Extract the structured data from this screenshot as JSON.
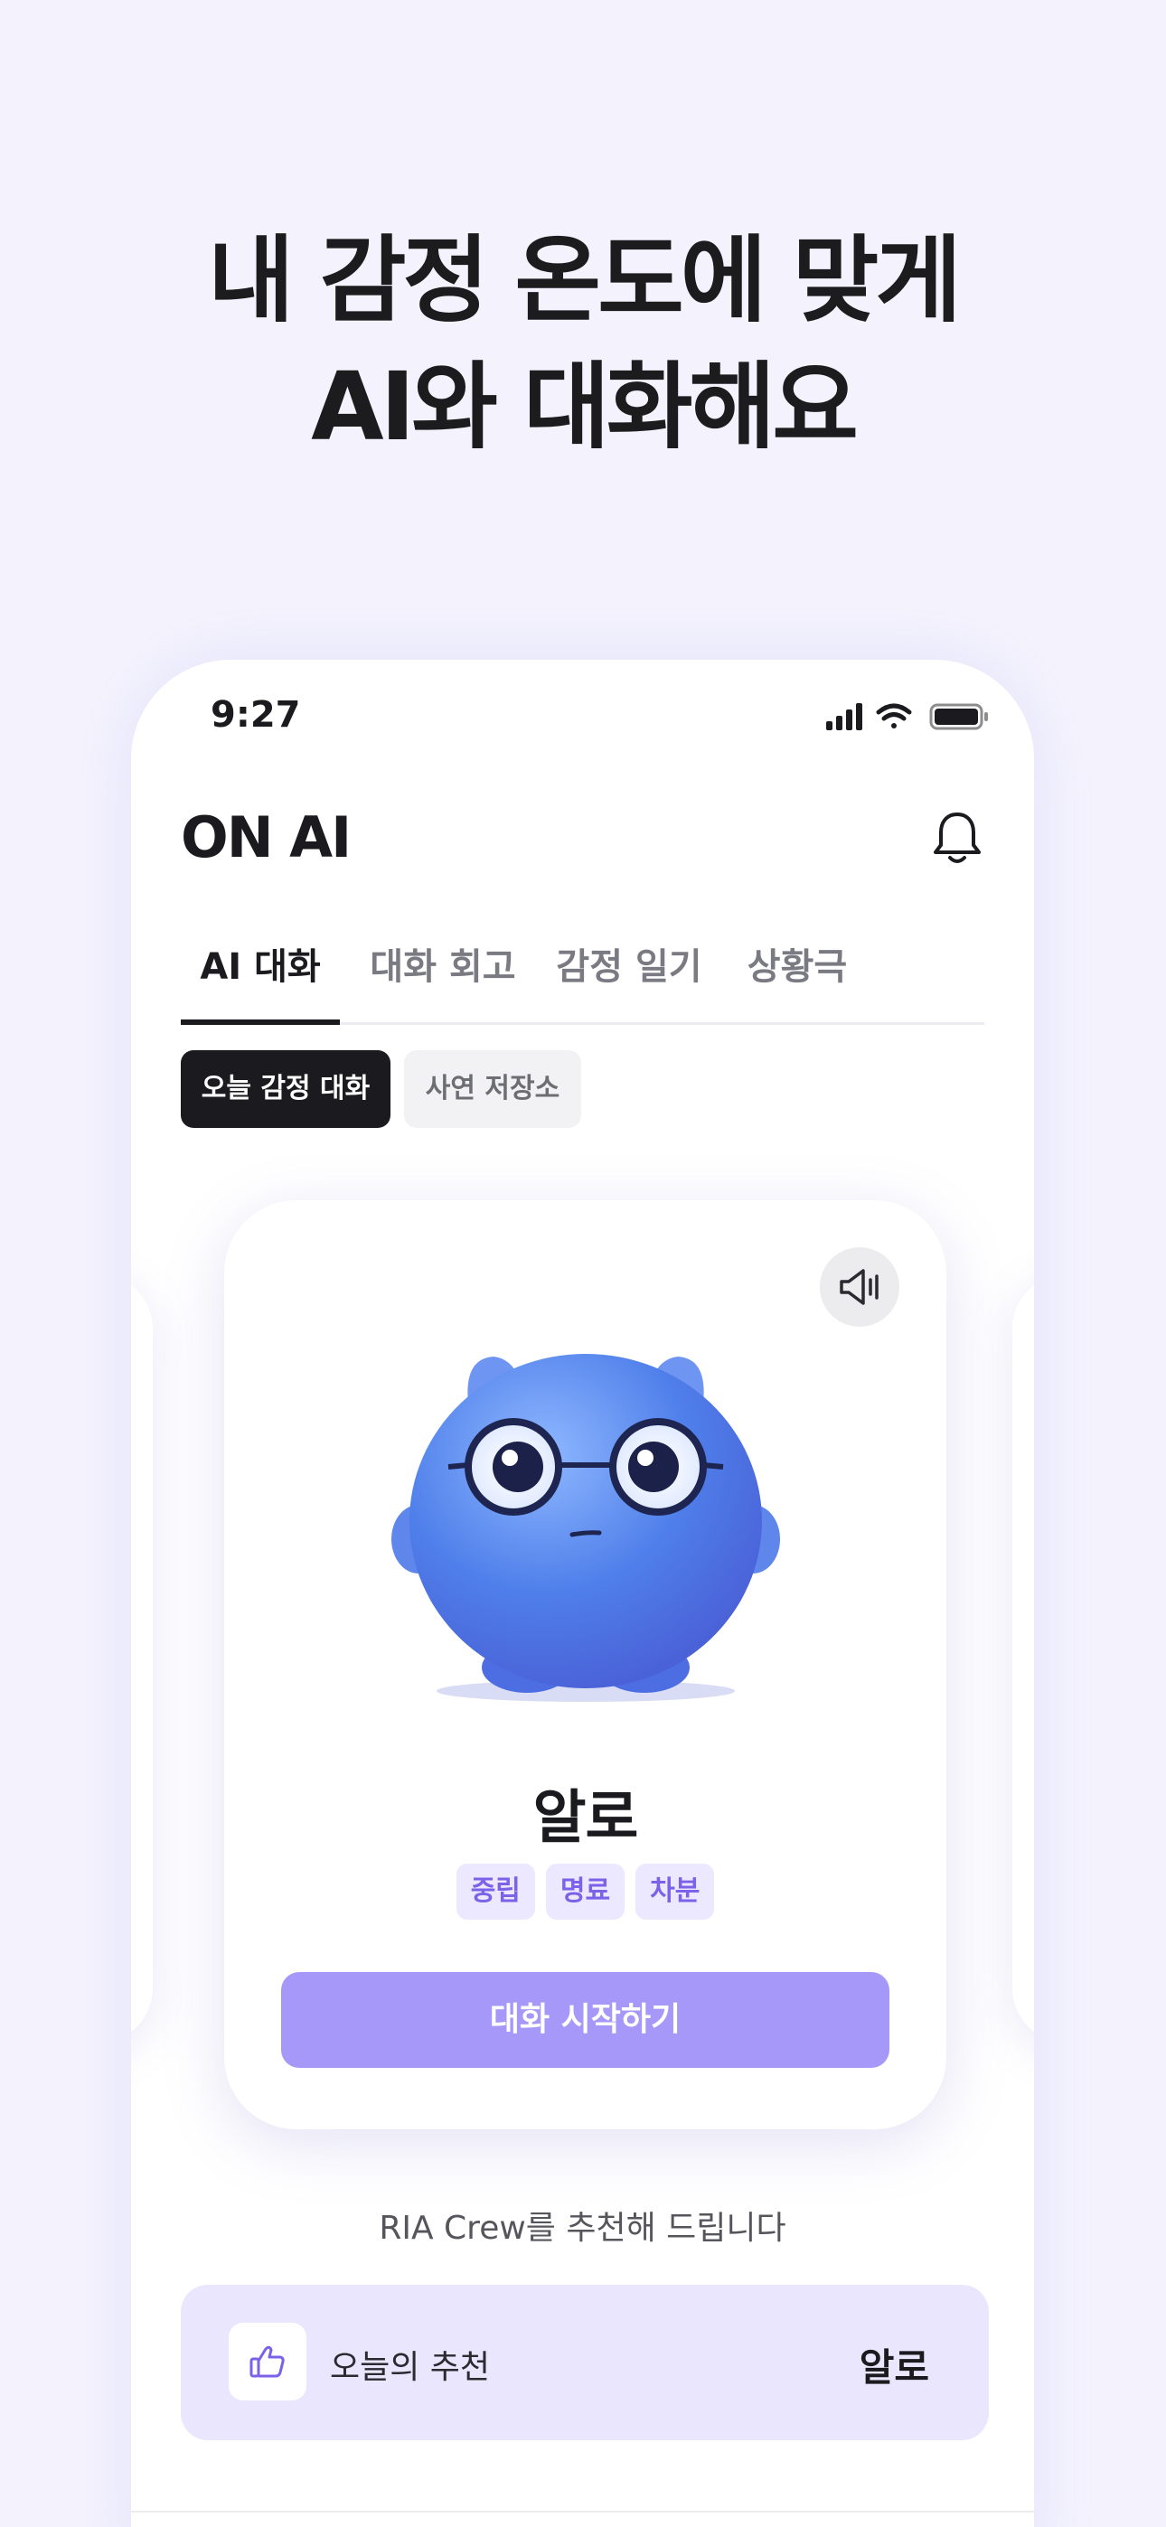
{
  "headline": {
    "line1": "내 감정 온도에 맞게",
    "line2": "AI와 대화해요"
  },
  "status_bar": {
    "time": "9:27",
    "icons": [
      "signal-icon",
      "wifi-icon",
      "battery-icon"
    ]
  },
  "app": {
    "title": "ON AI",
    "bell_icon": "bell-icon"
  },
  "tabs": [
    {
      "label": "AI 대화",
      "active": true
    },
    {
      "label": "대화 회고",
      "active": false
    },
    {
      "label": "감정 일기",
      "active": false
    },
    {
      "label": "상황극",
      "active": false
    }
  ],
  "chips": [
    {
      "label": "오늘 감정 대화",
      "active": true
    },
    {
      "label": "사연 저장소",
      "active": false
    }
  ],
  "character_card": {
    "speaker_icon": "speaker-icon",
    "name": "알로",
    "tags": [
      "중립",
      "명료",
      "차분"
    ],
    "start_button": "대화 시작하기"
  },
  "recommendation": {
    "text": "RIA Crew를 추천해 드립니다",
    "today_label": "오늘의 추천",
    "today_value": "알로",
    "thumb_icon": "thumbs-up-icon"
  },
  "colors": {
    "accent": "#a698f8",
    "tag_bg": "#ebe8ff",
    "tag_text": "#7b62e8",
    "recommend_bg": "#e9e6fd",
    "page_bg": "#f4f3fd"
  }
}
